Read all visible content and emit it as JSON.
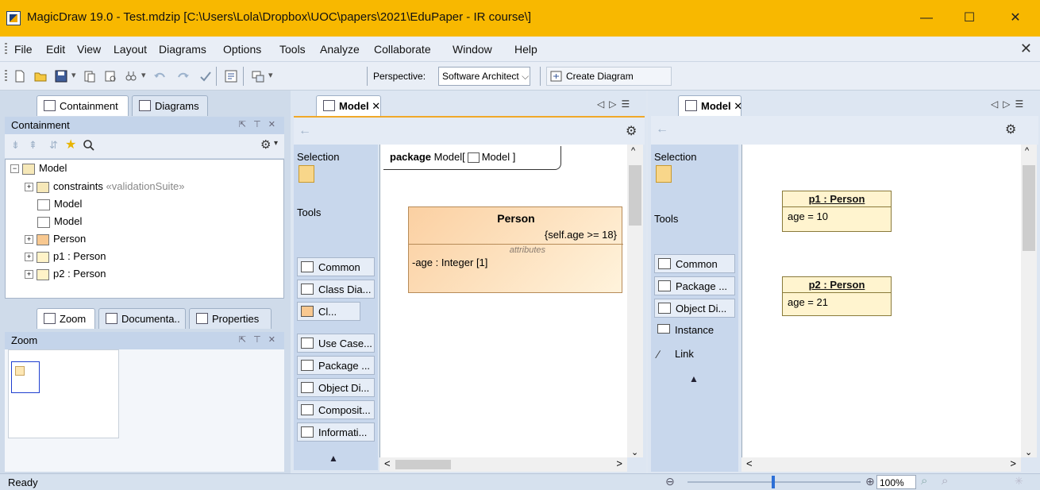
{
  "window": {
    "title": "MagicDraw 19.0 - Test.mdzip [C:\\Users\\Lola\\Dropbox\\UOC\\papers\\2021\\EduPaper - IR course\\]",
    "minimize": "—",
    "maximize": "☐",
    "close": "✕"
  },
  "menu": {
    "items": [
      "File",
      "Edit",
      "View",
      "Layout",
      "Diagrams",
      "Options",
      "Tools",
      "Analyze",
      "Collaborate",
      "Window",
      "Help"
    ],
    "close": "✕"
  },
  "toolbar": {
    "perspective_label": "Perspective:",
    "perspective_value": "Software Architect",
    "create_diagram": "Create Diagram"
  },
  "left_top": {
    "tabs": [
      "Containment",
      "Diagrams"
    ],
    "title": "Containment",
    "tree": [
      {
        "label": "Model",
        "stereo": ""
      },
      {
        "label": "constraints",
        "stereo": "«validationSuite»"
      },
      {
        "label": "Model",
        "stereo": ""
      },
      {
        "label": "Model",
        "stereo": ""
      },
      {
        "label": "Person",
        "stereo": ""
      },
      {
        "label": "p1 : Person",
        "stereo": ""
      },
      {
        "label": "p2 : Person",
        "stereo": ""
      }
    ]
  },
  "left_bottom": {
    "tabs": [
      "Zoom",
      "Documenta..",
      "Properties"
    ],
    "title": "Zoom"
  },
  "center": {
    "tab": "Model",
    "palette": {
      "selection": "Selection",
      "tools": "Tools",
      "buttons": [
        "Common",
        "Class Dia...",
        "Cl...",
        "Use Case...",
        "Package ...",
        "Object Di...",
        "Composit...",
        "Informati..."
      ]
    },
    "frame_keyword": "package",
    "frame_name": "Model[",
    "frame_icon_label": "Model ]",
    "class": {
      "name": "Person",
      "constraint": "{self.age >= 18}",
      "compartment": "attributes",
      "attribute": "-age : Integer [1]"
    }
  },
  "right": {
    "tab": "Model",
    "palette": {
      "selection": "Selection",
      "tools": "Tools",
      "buttons": [
        "Common",
        "Package ...",
        "Object Di..."
      ],
      "plain": [
        "Instance",
        "Link"
      ]
    },
    "objects": [
      {
        "name": "p1 : Person",
        "slot": "age = 10"
      },
      {
        "name": "p2 : Person",
        "slot": "age = 21"
      }
    ]
  },
  "status": {
    "text": "Ready",
    "zoom": "100%"
  }
}
